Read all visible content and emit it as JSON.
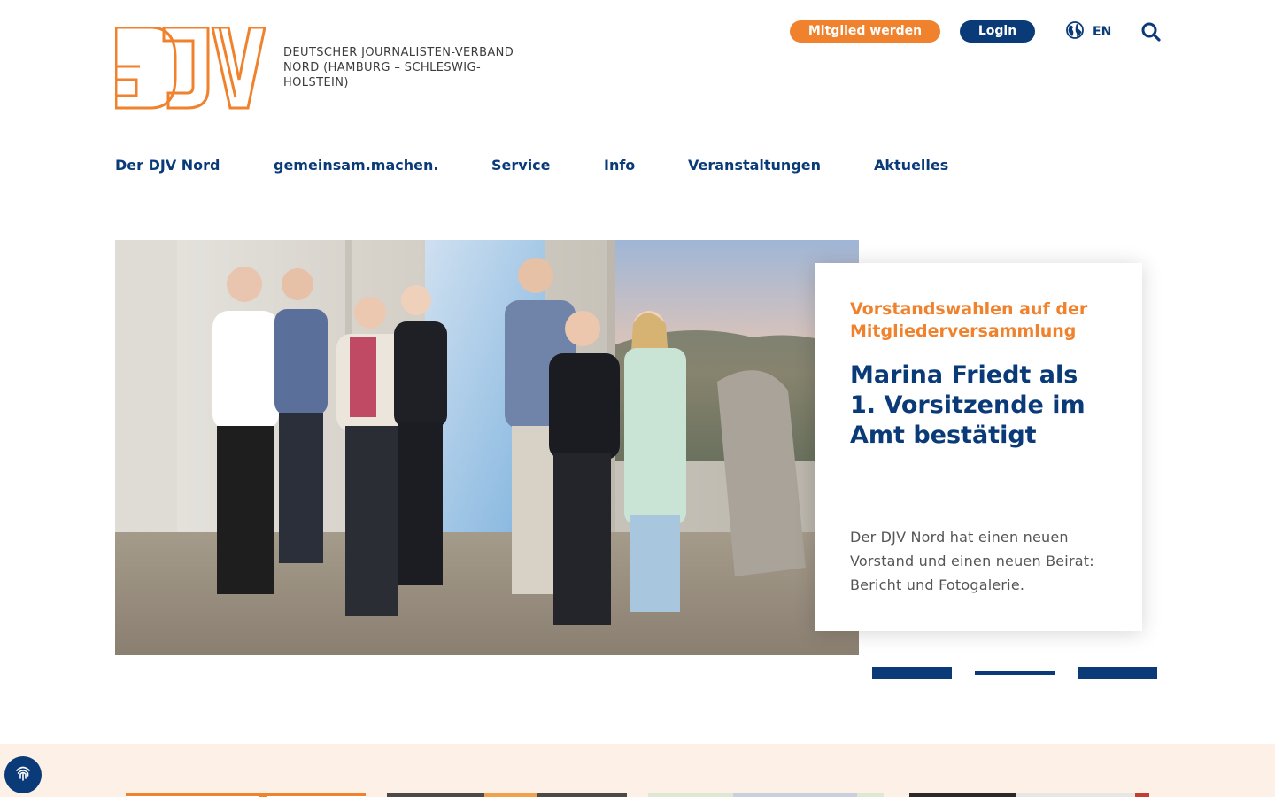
{
  "header": {
    "logo_text": "DJV",
    "org_name": "Deutscher Journalisten-Verband Nord (Hamburg – Schleswig-Holstein)",
    "member_button": "Mitglied werden",
    "login_button": "Login",
    "language": "EN"
  },
  "nav": {
    "items": [
      {
        "label": "Der DJV Nord"
      },
      {
        "label": "gemeinsam.machen."
      },
      {
        "label": "Service"
      },
      {
        "label": "Info"
      },
      {
        "label": "Veranstaltungen"
      },
      {
        "label": "Aktuelles"
      }
    ]
  },
  "hero": {
    "kicker": "Vorstandswahlen auf der Mitgliederversammlung",
    "title": "Marina Friedt als 1. Vorsitzende im Amt bestätigt",
    "text": "Der DJV Nord hat einen neuen Vorstand und einen neuen Beirat: Bericht und Fotogalerie.",
    "slides_total": 3,
    "active_slide": 2
  },
  "colors": {
    "brand_blue": "#0a3b78",
    "brand_orange": "#f0822d",
    "band_bg": "#fdf1e7"
  },
  "icons": {
    "language": "globe-icon",
    "search": "search-icon",
    "consent": "fingerprint-icon"
  }
}
